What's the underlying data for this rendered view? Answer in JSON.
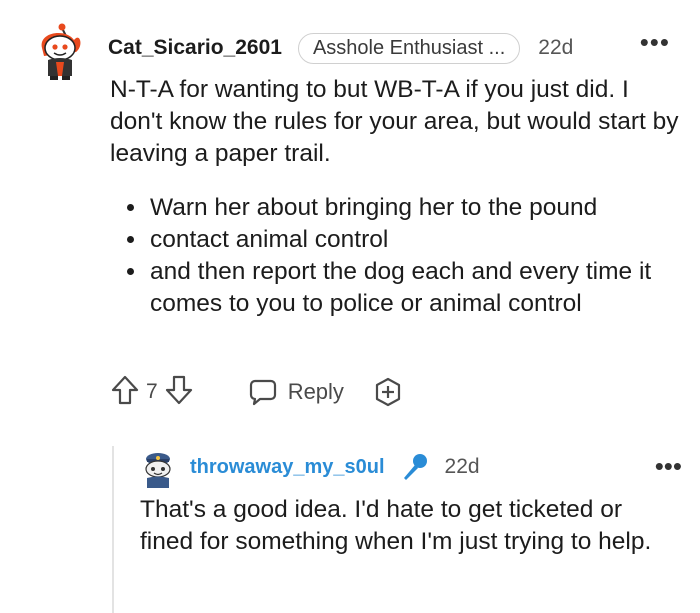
{
  "comment": {
    "username": "Cat_Sicario_2601",
    "flair": "Asshole Enthusiast ...",
    "time": "22d",
    "more": "•••",
    "paragraph": "N-T-A for wanting to but WB-T-A if you just did. I don't know the rules for your area, but would start by leaving a paper trail.",
    "bullets": [
      "Warn her about bringing her to the pound",
      "contact animal control",
      "and then report the dog each and every time it comes to you to police or animal control"
    ],
    "votes": "7",
    "reply_label": "Reply",
    "avatar_icon": "reddit-snoo-avatar-icon"
  },
  "reply": {
    "username": "throwaway_my_s0ul",
    "time": "22d",
    "more": "•••",
    "text": "That's a good idea. I'd hate to get ticketed or fined for something when I'm just trying to help.",
    "avatar_icon": "snoo-police-avatar-icon",
    "badge_icon": "microphone-icon"
  },
  "colors": {
    "username_reply": "#2a8cd6",
    "accent_orange": "#e8491d",
    "mic_blue": "#2a8cd6"
  }
}
